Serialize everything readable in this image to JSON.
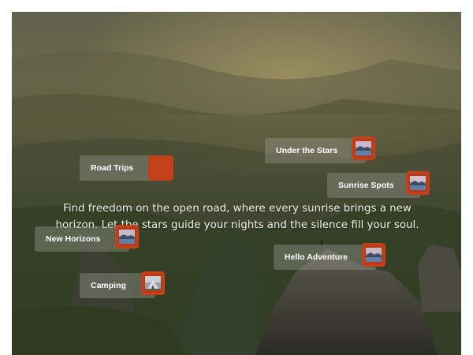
{
  "tagline": "Find freedom on the open road, where every sunrise brings a new horizon. Let the stars guide your nights and the silence fill your soul.",
  "tags": [
    {
      "label": "Road Trips",
      "thumbnail": "none"
    },
    {
      "label": "Under the Stars",
      "thumbnail": "mountain-lake-image"
    },
    {
      "label": "Sunrise Spots",
      "thumbnail": "mountain-lake-image"
    },
    {
      "label": "New Horizons",
      "thumbnail": "mountain-lake-image"
    },
    {
      "label": "Hello Adventure",
      "thumbnail": "mountain-lake-image"
    },
    {
      "label": "Camping",
      "thumbnail": "camping-image"
    }
  ],
  "colors": {
    "accent": "#c2401a",
    "pill_background": "rgba(150,150,140,0.42)"
  }
}
